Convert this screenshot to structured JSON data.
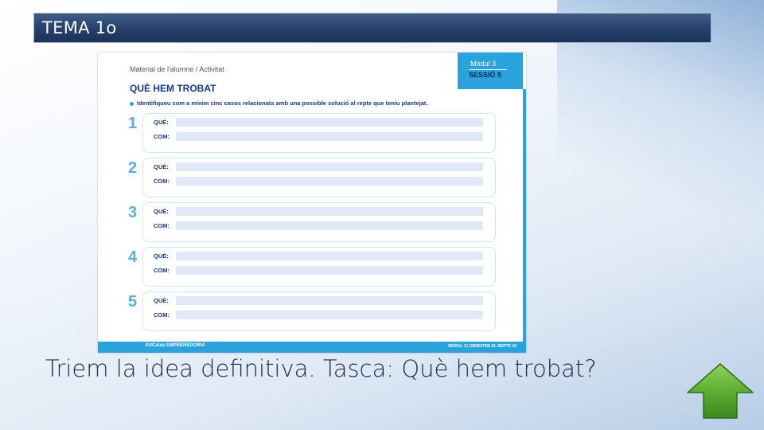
{
  "header": {
    "title": "TEMA 1o"
  },
  "worksheet": {
    "header_label": "Material de l'alumne / Activitat",
    "title": "QUÈ HEM TROBAT",
    "module_label": "Mòdul 3",
    "session_label": "SESSIÓ 5",
    "instruction": "Identifiqueu com a mínim cinc casos relacionats amb una possible solució al repte que teníu plantejat.",
    "rows": [
      {
        "number": "1",
        "que_label": "QUÈ:",
        "com_label": "COM:"
      },
      {
        "number": "2",
        "que_label": "QUÈ:",
        "com_label": "COM:"
      },
      {
        "number": "3",
        "que_label": "QUÈ:",
        "com_label": "COM:"
      },
      {
        "number": "4",
        "que_label": "QUÈ:",
        "com_label": "COM:"
      },
      {
        "number": "5",
        "que_label": "QUÈ:",
        "com_label": "COM:"
      }
    ],
    "footer_left": "KitCaixa EMPRENEDORIA",
    "footer_right": "MÒDUL 3 | ORIENTEM EL REPTE 16"
  },
  "caption": "Triem la idea definitiva. Tasca: Què hem trobat?",
  "colors": {
    "title_bar": "#25406a",
    "worksheet_accent": "#2aa2dc",
    "arrow_green": "#4a9a2a"
  },
  "icons": {
    "next_button": "up-arrow-icon"
  }
}
